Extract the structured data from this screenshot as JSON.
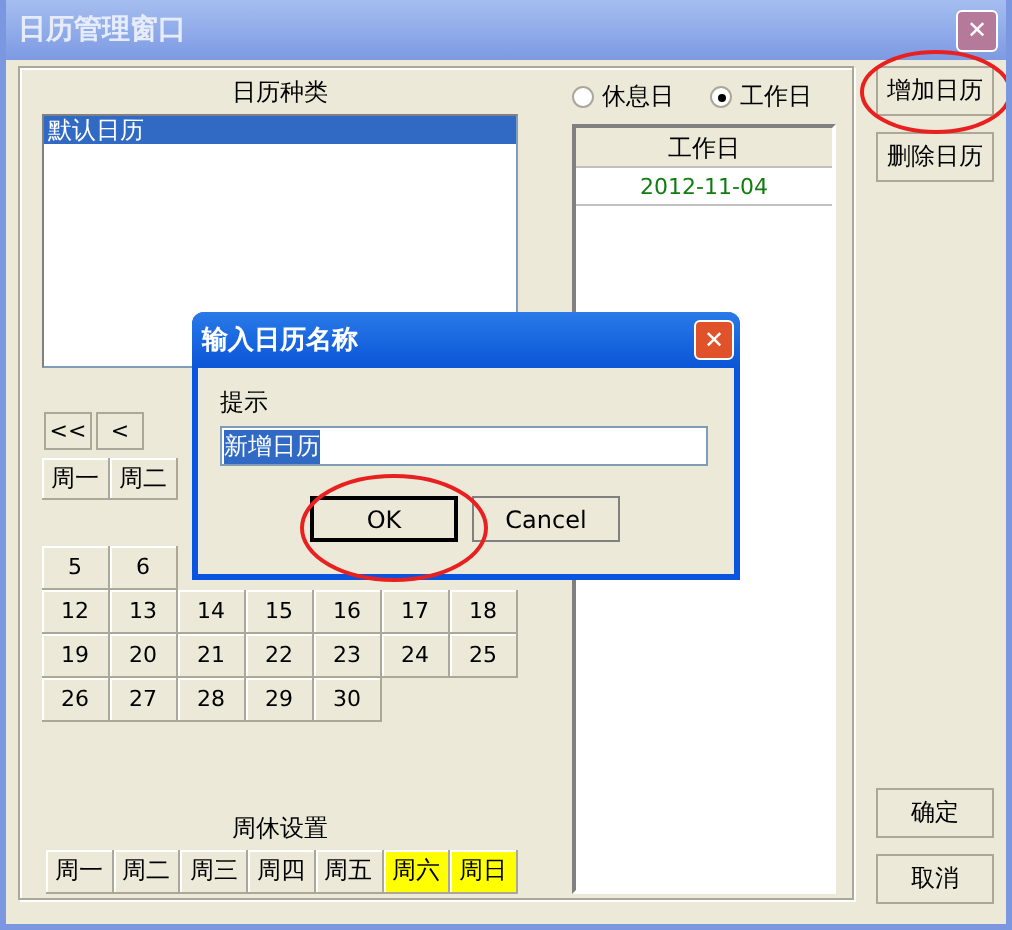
{
  "window": {
    "title": "日历管理窗口",
    "close": "✕"
  },
  "calendar_types": {
    "label": "日历种类",
    "items": [
      {
        "text": "默认日历",
        "selected": true
      }
    ]
  },
  "day_type": [
    {
      "label": "休息日",
      "selected": false
    },
    {
      "label": "工作日",
      "selected": true
    }
  ],
  "workday_table": {
    "column": "工作日",
    "rows": [
      "2012-11-04"
    ]
  },
  "calendar_nav": [
    "<<",
    "<"
  ],
  "weekday_header": [
    "周一",
    "周二"
  ],
  "weeks": [
    [
      "5",
      "6"
    ],
    [
      "12",
      "13",
      "14",
      "15",
      "16",
      "17",
      "18"
    ],
    [
      "19",
      "20",
      "21",
      "22",
      "23",
      "24",
      "25"
    ],
    [
      "26",
      "27",
      "28",
      "29",
      "30"
    ]
  ],
  "weekly_rest": {
    "label": "周休设置",
    "days": [
      {
        "label": "周一",
        "selected": false
      },
      {
        "label": "周二",
        "selected": false
      },
      {
        "label": "周三",
        "selected": false
      },
      {
        "label": "周四",
        "selected": false
      },
      {
        "label": "周五",
        "selected": false
      },
      {
        "label": "周六",
        "selected": true
      },
      {
        "label": "周日",
        "selected": true
      }
    ]
  },
  "side_buttons": [
    {
      "label": "增加日历",
      "kind": "top"
    },
    {
      "label": "删除日历",
      "kind": "top"
    },
    {
      "label": "确定",
      "kind": "bottom"
    },
    {
      "label": "取消",
      "kind": "bottom"
    }
  ],
  "dialog": {
    "title": "输入日历名称",
    "close": "✕",
    "prompt": "提示",
    "input": {
      "value": "新增日历",
      "text_selected": true
    },
    "buttons": [
      "OK",
      "Cancel"
    ]
  }
}
